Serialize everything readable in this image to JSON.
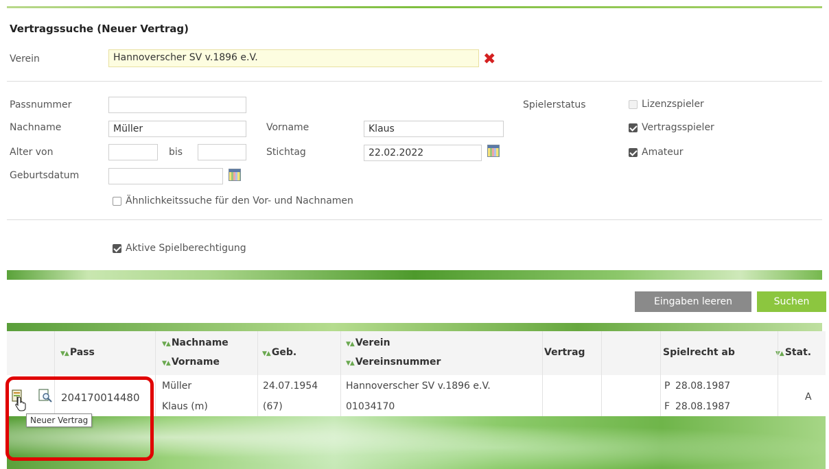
{
  "header": {
    "title": "Vertragssuche (Neuer Vertrag)"
  },
  "verein": {
    "label": "Verein",
    "value": "Hannoverscher SV v.1896 e.V."
  },
  "form": {
    "passnummer": {
      "label": "Passnummer",
      "value": ""
    },
    "nachname": {
      "label": "Nachname",
      "value": "Müller"
    },
    "vorname": {
      "label": "Vorname",
      "value": "Klaus"
    },
    "alter_von": {
      "label": "Alter von",
      "value": ""
    },
    "bis": {
      "label": "bis",
      "value": ""
    },
    "stichtag": {
      "label": "Stichtag",
      "value": "22.02.2022"
    },
    "geburtsdatum": {
      "label": "Geburtsdatum",
      "value": ""
    },
    "aehnlichkeit": {
      "label": "Ähnlichkeitssuche für den Vor- und Nachnamen",
      "checked": false
    },
    "spielerstatus_label": "Spielerstatus",
    "status": [
      {
        "label": "Lizenzspieler",
        "checked": false
      },
      {
        "label": "Vertragsspieler",
        "checked": true
      },
      {
        "label": "Amateur",
        "checked": true
      }
    ],
    "aktive": {
      "label": "Aktive Spielberechtigung",
      "checked": true
    }
  },
  "buttons": {
    "clear": "Eingaben leeren",
    "search": "Suchen"
  },
  "table": {
    "headers": {
      "pass": "Pass",
      "nachname": "Nachname",
      "vorname": "Vorname",
      "geb": "Geb.",
      "verein": "Verein",
      "vereinsnummer": "Vereinsnummer",
      "vertrag": "Vertrag",
      "spielrecht": "Spielrecht ab",
      "stat": "Stat."
    },
    "row": {
      "pass": "204170014480",
      "nachname": "Müller",
      "vorname": "Klaus (m)",
      "geb": "24.07.1954",
      "alter": "(67)",
      "verein": "Hannoverscher SV v.1896 e.V.",
      "vereinsnummer": "01034170",
      "spielrecht_p_code": "P",
      "spielrecht_p": "28.08.1987",
      "spielrecht_f_code": "F",
      "spielrecht_f": "28.08.1987",
      "stat": "A"
    }
  },
  "tooltip": "Neuer Vertrag",
  "icons": {
    "new_contract": "new-contract-icon",
    "view": "view-icon",
    "remove": "remove-icon",
    "calendar": "calendar-icon",
    "sort": "sort-icon"
  }
}
